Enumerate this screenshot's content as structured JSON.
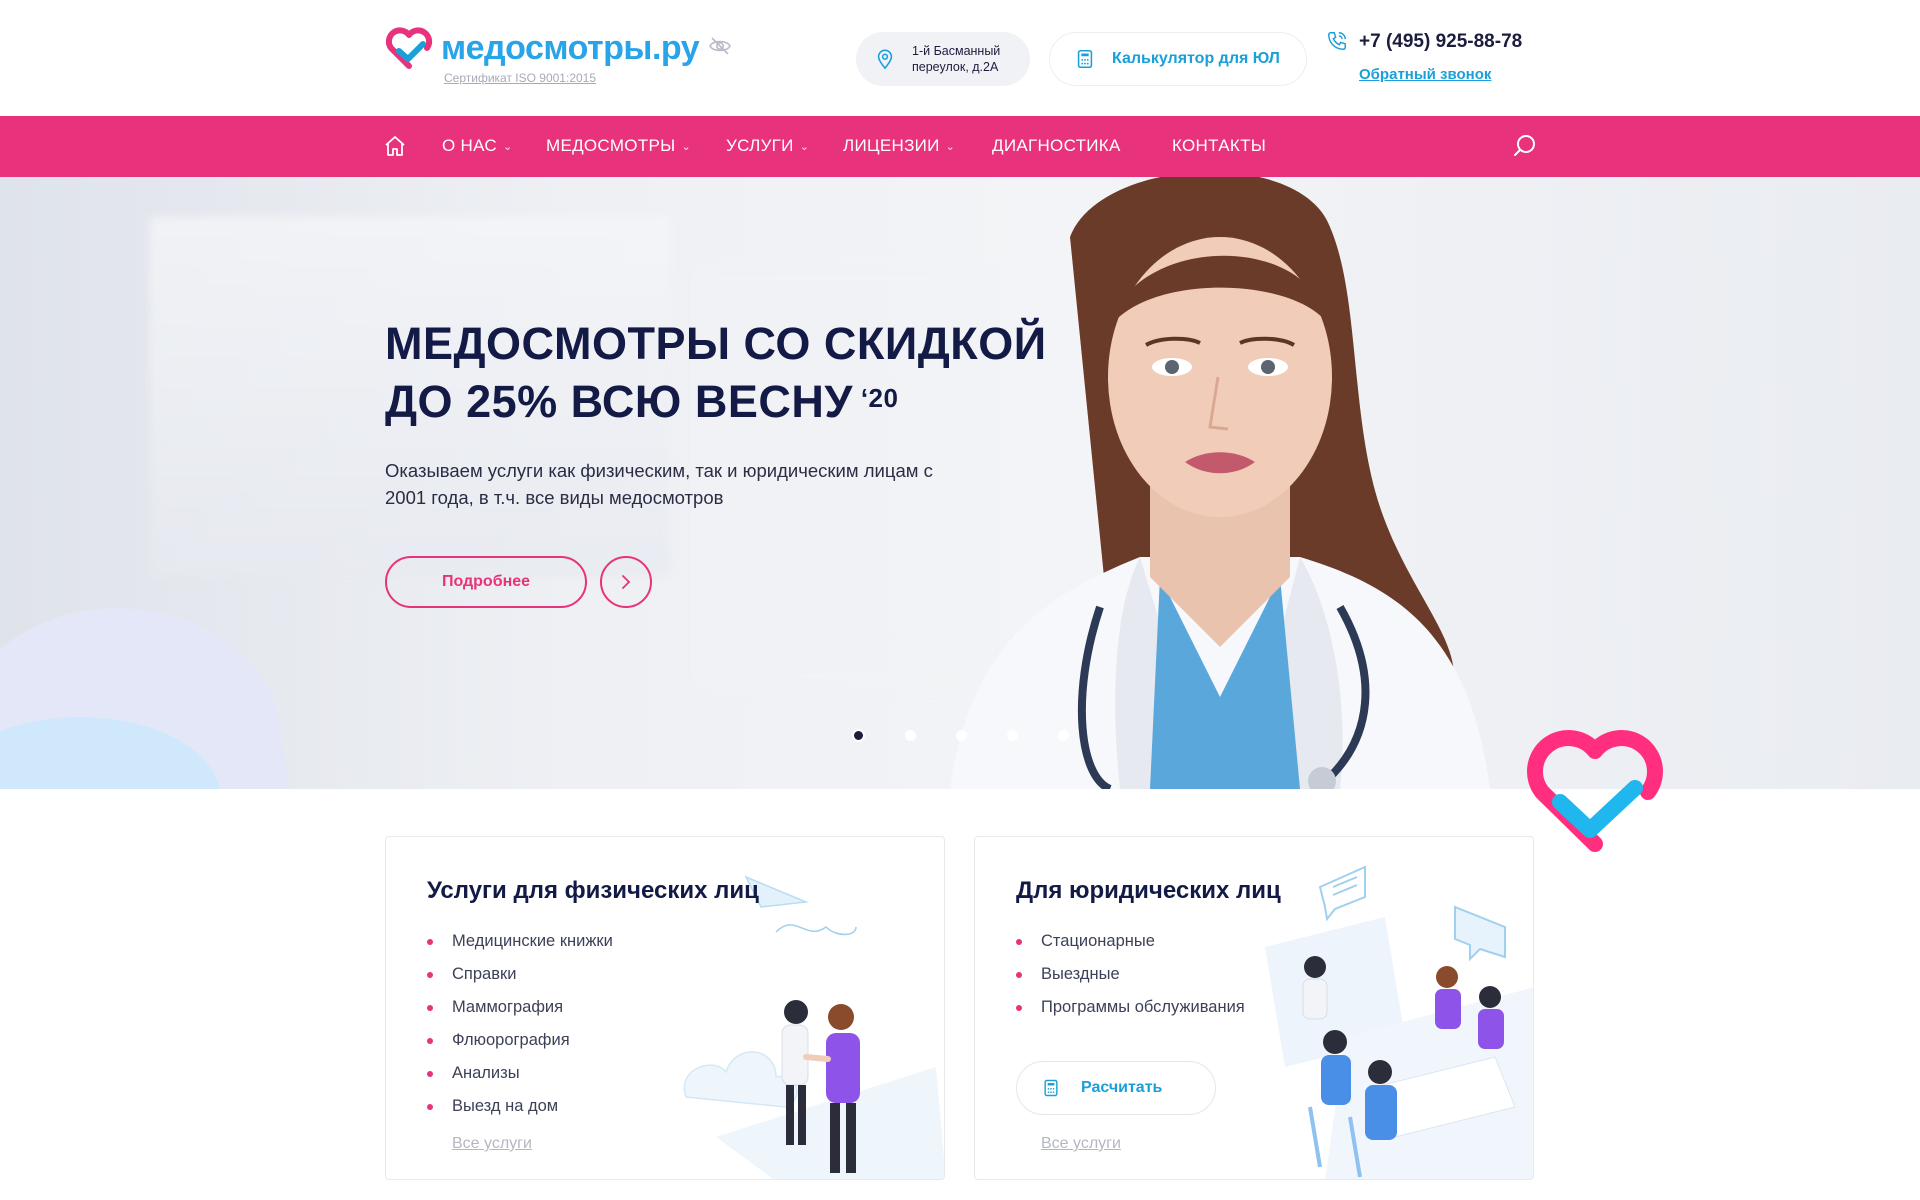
{
  "header": {
    "logo_text": "медосмотры.ру",
    "certificate": "Сертификат ISO 9001:2015",
    "address": "1-й Басманный переулок, д.2А",
    "calculator_label": "Калькулятор для ЮЛ",
    "phone": "+7 (495) 925-88-78",
    "callback_label": "Обратный звонок",
    "icons": [
      "logo-heart-icon",
      "eye-off-icon",
      "location-pin-icon",
      "calculator-icon",
      "phone-icon"
    ]
  },
  "nav": {
    "items": [
      {
        "label": "О НАС",
        "has_dropdown": true
      },
      {
        "label": "МЕДОСМОТРЫ",
        "has_dropdown": true
      },
      {
        "label": "УСЛУГИ",
        "has_dropdown": true
      },
      {
        "label": "ЛИЦЕНЗИИ",
        "has_dropdown": true
      },
      {
        "label": "ДИАГНОСТИКА",
        "has_dropdown": false
      },
      {
        "label": "КОНТАКТЫ",
        "has_dropdown": false
      }
    ],
    "icons": [
      "home-icon",
      "search-icon"
    ]
  },
  "hero": {
    "title_line1": "МЕДОСМОТРЫ СО СКИДКОЙ",
    "title_line2": "ДО 25% ВСЮ ВЕСНУ",
    "title_sup": "‘20",
    "subtitle": "Оказываем услуги как физическим, так и юридическим лицам с 2001 года, в т.ч. все виды медосмотров",
    "more_button": "Подробнее",
    "slides_total": 5,
    "active_slide": 1
  },
  "cards": {
    "individuals": {
      "title": "Услуги для физических лиц",
      "items": [
        "Медицинские книжки",
        "Справки",
        "Маммография",
        "Флюорография",
        "Анализы",
        "Выезд на дом"
      ],
      "link": "Все услуги"
    },
    "companies": {
      "title": "Для юридических лиц",
      "items": [
        "Стационарные",
        "Выездные",
        "Программы обслуживания"
      ],
      "calc_button": "Расчитать",
      "link": "Все услуги"
    }
  },
  "colors": {
    "brand_pink": "#e8327b",
    "brand_blue": "#1aa0d8",
    "navy": "#121a45"
  }
}
